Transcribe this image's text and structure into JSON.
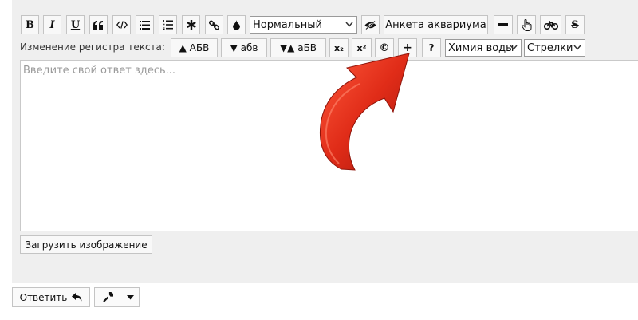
{
  "toolbar1": {
    "bold": "B",
    "italic": "I",
    "underline": "U",
    "format_select": "Нормальный",
    "aquarium_button": "Анкета аквариума"
  },
  "toolbar2": {
    "case_label": "Изменение регистра текста:",
    "upper_button": "▲ АБВ",
    "lower_button": "▼ абв",
    "toggle_button": "▼▲ аБВ",
    "subscript": "x₂",
    "superscript": "x²",
    "copyright": "©",
    "help": "?",
    "chemistry_select": "Химия воды",
    "arrows_select": "Стрелки"
  },
  "editor": {
    "placeholder": "Введите свой ответ здесь..."
  },
  "upload_button": "Загрузить изображение",
  "reply_button": "Ответить",
  "colors": {
    "panel_bg": "#efefef",
    "arrow_red": "#d82a1a"
  }
}
